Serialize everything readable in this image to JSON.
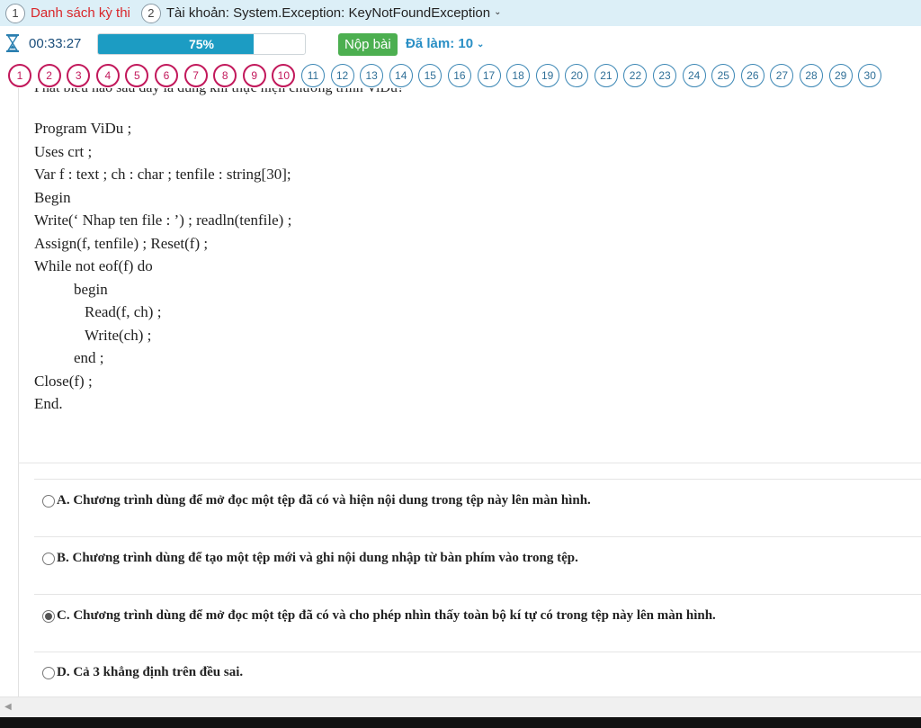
{
  "breadcrumb": [
    {
      "num": "1",
      "label": "Danh sách kỳ thi"
    },
    {
      "num": "2",
      "label": "Tài khoản: System.Exception: KeyNotFoundException"
    }
  ],
  "status": {
    "timer": "00:33:27",
    "progress_label": "75%",
    "progress_fraction": 0.75,
    "submit_label": "Nộp bài",
    "done_label": "Đã làm: 10"
  },
  "questions_nav": {
    "answered_count": 10,
    "numbers": [
      "1",
      "2",
      "3",
      "4",
      "5",
      "6",
      "7",
      "8",
      "9",
      "10",
      "11",
      "12",
      "13",
      "14",
      "15",
      "16",
      "17",
      "18",
      "19",
      "20",
      "21",
      "22",
      "23",
      "24",
      "25",
      "26",
      "27",
      "28",
      "29",
      "30"
    ]
  },
  "question": {
    "prompt_partial": "Phát biểu nào sau đây là đúng khi thực hiện chương trình ViDu?",
    "code_lines": [
      "Program ViDu ;",
      "Uses crt ;",
      "Var f : text ; ch : char ; tenfile : string[30];",
      "Begin",
      "Write(‘ Nhap ten file : ’) ; readln(tenfile) ;",
      "Assign(f, tenfile) ; Reset(f) ;",
      "While not eof(f) do",
      "begin",
      "Read(f, ch) ;",
      "Write(ch) ;",
      "end ;",
      "Close(f) ;",
      "End."
    ],
    "options": [
      {
        "label": "A. Chương trình dùng để mở đọc một tệp đã có và hiện nội dung trong tệp này lên màn hình.",
        "checked": false
      },
      {
        "label": "B. Chương trình dùng để tạo một tệp mới và ghi nội dung nhập từ bàn phím vào trong tệp.",
        "checked": false
      },
      {
        "label": "C. Chương trình dùng để mở đọc một tệp đã có và cho phép nhìn thấy toàn bộ kí tự có trong tệp này lên màn hình.",
        "checked": true
      },
      {
        "label": "D. Cả 3 khẳng định trên đều sai.",
        "checked": false
      }
    ]
  },
  "colors": {
    "topbar_bg": "#dceff7",
    "answered": "#c2185b",
    "pending": "#3a86b4",
    "progress": "#1c9cc3",
    "submit": "#4caf50",
    "link_red": "#d9262a"
  },
  "icons": {
    "timer": "hourglass-icon",
    "dropdown": "chevron-down-icon",
    "radio": "radio-button-icon",
    "scroll": "scroll-left-arrow-icon"
  }
}
